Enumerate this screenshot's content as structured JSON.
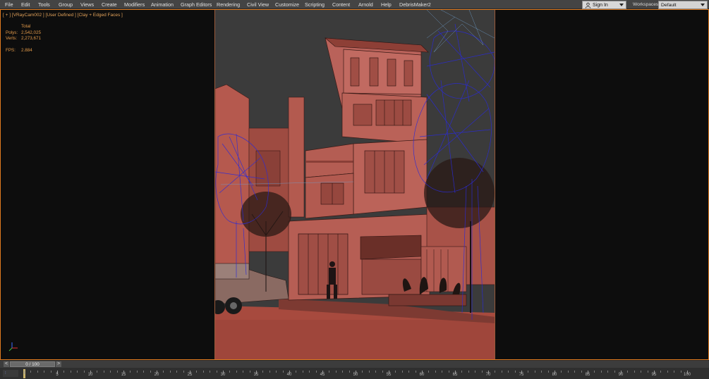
{
  "menu": {
    "items": [
      "File",
      "Edit",
      "Tools",
      "Group",
      "Views",
      "Create",
      "Modifiers",
      "Animation",
      "Graph Editors",
      "Rendering",
      "Civil View",
      "Customize",
      "Scripting",
      "Content",
      "Arnold",
      "Help",
      "DebrisMaker2"
    ],
    "sign_in": "Sign In",
    "workspaces_label": "Workspaces:",
    "workspace_value": "Default"
  },
  "viewport": {
    "label": "[ + ] [VRayCam002 ] [User Defined ] [Clay + Edged Faces ]",
    "stats": {
      "header": "Total",
      "polys_label": "Polys:",
      "polys_value": "2,542,025",
      "verts_label": "Verts:",
      "verts_value": "2,273,671",
      "fps_label": "FPS:",
      "fps_value": "2.884"
    }
  },
  "timeline": {
    "frame_display": "0 / 100",
    "prev_label": "<",
    "next_label": ">",
    "tick_labels": [
      "5",
      "10",
      "15",
      "20",
      "25",
      "30",
      "35",
      "40",
      "45",
      "50",
      "55",
      "60",
      "65",
      "70",
      "75",
      "80",
      "85",
      "90",
      "95",
      "100"
    ]
  },
  "colors": {
    "accent_orange": "#e07a1f",
    "stat_text": "#e29a4a",
    "building_clay": "#b5594e",
    "tree_wire": "#2a2ad8"
  }
}
